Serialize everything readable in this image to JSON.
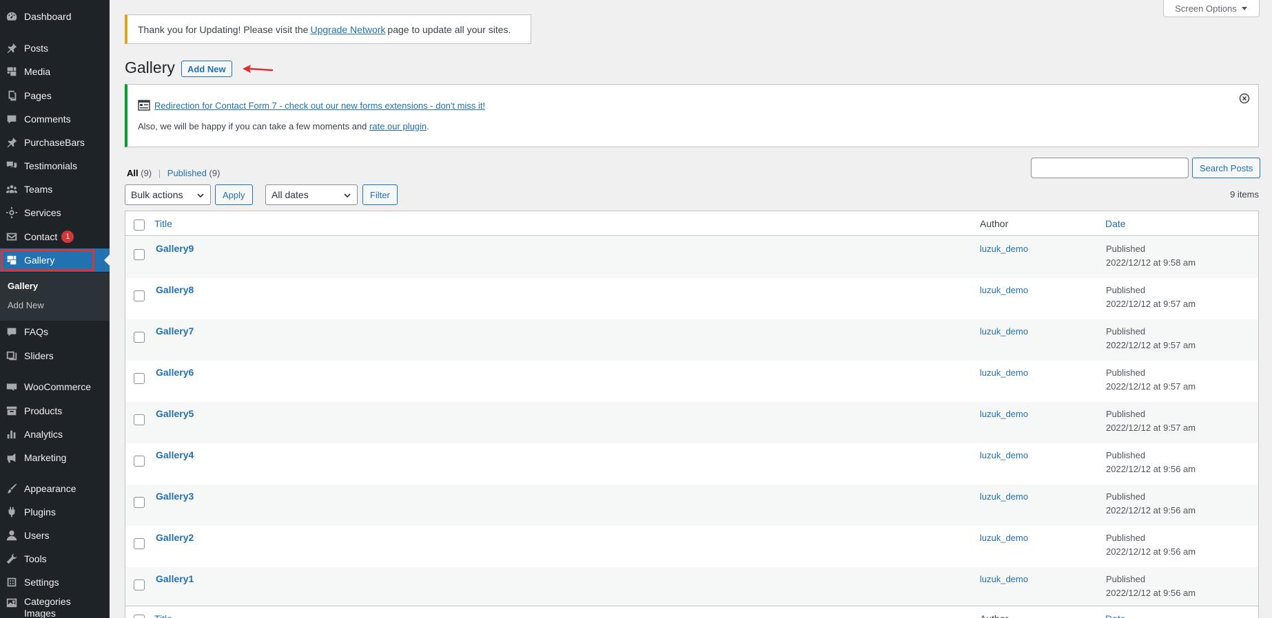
{
  "sidebar": {
    "items": [
      {
        "label": "Dashboard",
        "icon": "dashboard-icon"
      },
      {
        "label": "Posts",
        "icon": "pin-icon"
      },
      {
        "label": "Media",
        "icon": "media-icon"
      },
      {
        "label": "Pages",
        "icon": "pages-icon"
      },
      {
        "label": "Comments",
        "icon": "comment-icon"
      },
      {
        "label": "PurchaseBars",
        "icon": "pin-icon"
      },
      {
        "label": "Testimonials",
        "icon": "testimonial-icon"
      },
      {
        "label": "Teams",
        "icon": "groups-icon"
      },
      {
        "label": "Services",
        "icon": "gear-icon"
      },
      {
        "label": "Contact",
        "icon": "envelope-icon",
        "badge": "1"
      },
      {
        "label": "Gallery",
        "icon": "gallery-icon"
      },
      {
        "label": "FAQs",
        "icon": "comment-icon"
      },
      {
        "label": "Sliders",
        "icon": "slider-icon"
      },
      {
        "label": "WooCommerce",
        "icon": "woo-icon"
      },
      {
        "label": "Products",
        "icon": "archive-icon"
      },
      {
        "label": "Analytics",
        "icon": "bar-chart-icon"
      },
      {
        "label": "Marketing",
        "icon": "megaphone-icon"
      },
      {
        "label": "Appearance",
        "icon": "brush-icon"
      },
      {
        "label": "Plugins",
        "icon": "plug-icon"
      },
      {
        "label": "Users",
        "icon": "user-icon"
      },
      {
        "label": "Tools",
        "icon": "wrench-icon"
      },
      {
        "label": "Settings",
        "icon": "settings-icon"
      },
      {
        "label": "Categories Images",
        "icon": "image-icon"
      }
    ],
    "submenu": {
      "gallery": "Gallery",
      "add_new": "Add New"
    }
  },
  "screen_options": "Screen Options",
  "update_notice": {
    "before": "Thank you for Updating! Please visit the",
    "link": "Upgrade Network",
    "after": "page to update all your sites."
  },
  "heading": {
    "title": "Gallery",
    "add_new": "Add New"
  },
  "plugin_notice": {
    "link": "Redirection for Contact Form 7 - check out our new forms extensions - don't miss it!",
    "text_before": "Also, we will be happy if you can take a few moments and",
    "rate_link": "rate our plugin",
    "text_after": "."
  },
  "views": {
    "all": "All",
    "all_count": "(9)",
    "sep": "|",
    "published": "Published",
    "published_count": "(9)"
  },
  "search": {
    "button": "Search Posts",
    "placeholder": ""
  },
  "filters": {
    "bulk_actions": "Bulk actions",
    "apply": "Apply",
    "all_dates": "All dates",
    "filter": "Filter"
  },
  "items_count": "9 items",
  "table": {
    "columns": {
      "title": "Title",
      "author": "Author",
      "date": "Date"
    },
    "rows": [
      {
        "title": "Gallery9",
        "author": "luzuk_demo",
        "status": "Published",
        "date": "2022/12/12 at 9:58 am"
      },
      {
        "title": "Gallery8",
        "author": "luzuk_demo",
        "status": "Published",
        "date": "2022/12/12 at 9:57 am"
      },
      {
        "title": "Gallery7",
        "author": "luzuk_demo",
        "status": "Published",
        "date": "2022/12/12 at 9:57 am"
      },
      {
        "title": "Gallery6",
        "author": "luzuk_demo",
        "status": "Published",
        "date": "2022/12/12 at 9:57 am"
      },
      {
        "title": "Gallery5",
        "author": "luzuk_demo",
        "status": "Published",
        "date": "2022/12/12 at 9:57 am"
      },
      {
        "title": "Gallery4",
        "author": "luzuk_demo",
        "status": "Published",
        "date": "2022/12/12 at 9:56 am"
      },
      {
        "title": "Gallery3",
        "author": "luzuk_demo",
        "status": "Published",
        "date": "2022/12/12 at 9:56 am"
      },
      {
        "title": "Gallery2",
        "author": "luzuk_demo",
        "status": "Published",
        "date": "2022/12/12 at 9:56 am"
      },
      {
        "title": "Gallery1",
        "author": "luzuk_demo",
        "status": "Published",
        "date": "2022/12/12 at 9:56 am"
      }
    ]
  },
  "colors": {
    "sidebar_bg": "#1d2327",
    "accent": "#2271b1",
    "current": "#2271b1",
    "badge": "#d63638",
    "notice_warning": "#dba617",
    "notice_success": "#00a32a"
  }
}
